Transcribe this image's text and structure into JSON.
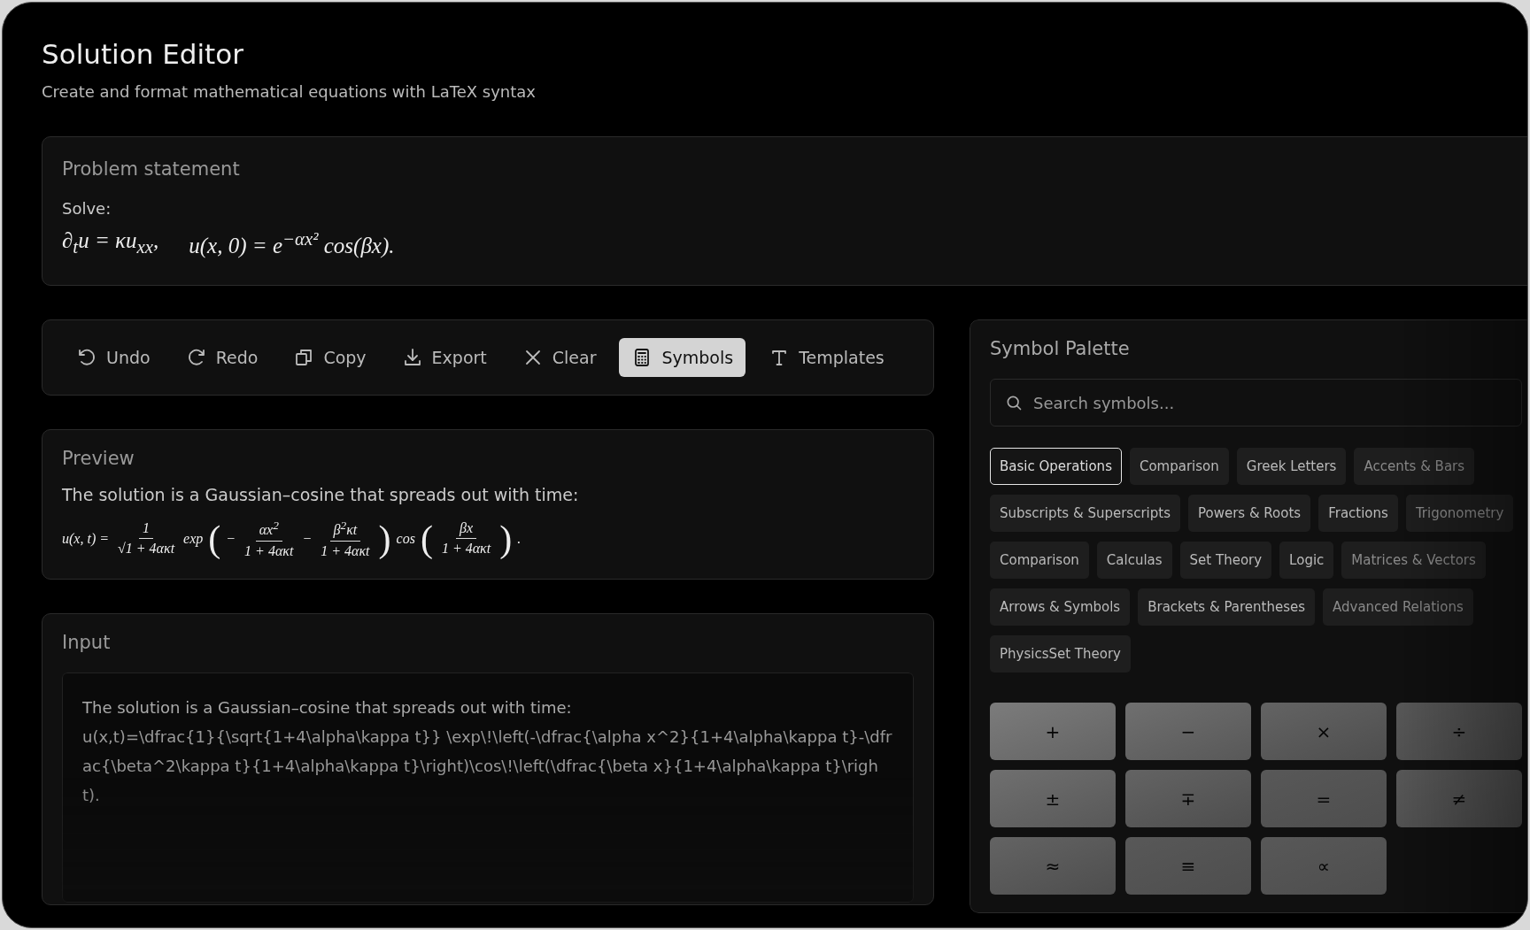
{
  "header": {
    "title": "Solution Editor",
    "subtitle": "Create and format mathematical equations with LaTeX syntax"
  },
  "problem": {
    "title": "Problem statement",
    "lead": "Solve:",
    "equations": [
      "∂$_{t}$u = κu$_{xx}$,",
      "u(x, 0) = e$^{−αx²}$ cos(βx)."
    ]
  },
  "toolbar": [
    {
      "kind": "undo",
      "label": "Undo",
      "selected": false
    },
    {
      "kind": "redo",
      "label": "Redo",
      "selected": false
    },
    {
      "kind": "copy",
      "label": "Copy",
      "selected": false
    },
    {
      "kind": "export",
      "label": "Export",
      "selected": false
    },
    {
      "kind": "clear",
      "label": "Clear",
      "selected": false
    },
    {
      "kind": "symbols",
      "label": "Symbols",
      "selected": true
    },
    {
      "kind": "templates",
      "label": "Templates",
      "selected": false
    }
  ],
  "preview": {
    "title": "Preview",
    "text": "The solution is a Gaussian–cosine that spreads out with time:",
    "formula": [
      {
        "kind": "text",
        "text": "u(x, t) ="
      },
      {
        "kind": "frac",
        "num": "1",
        "den": "√1 + 4ακt"
      },
      {
        "kind": "text",
        "text": "exp"
      },
      {
        "kind": "paren",
        "text": "("
      },
      {
        "kind": "text",
        "text": "−"
      },
      {
        "kind": "frac",
        "num": "αx$^{2}$",
        "den": "1 + 4ακt"
      },
      {
        "kind": "text",
        "text": "−"
      },
      {
        "kind": "frac",
        "num": "β$^{2}$κt",
        "den": "1 + 4ακt"
      },
      {
        "kind": "paren",
        "text": ")"
      },
      {
        "kind": "text",
        "text": "cos"
      },
      {
        "kind": "paren",
        "text": "("
      },
      {
        "kind": "frac",
        "num": "βx",
        "den": "1 + 4ακt"
      },
      {
        "kind": "paren",
        "text": ")"
      },
      {
        "kind": "text",
        "text": "."
      }
    ]
  },
  "input": {
    "title": "Input",
    "lines": [
      "The solution is a Gaussian–cosine that spreads out with time:",
      "u(x,t)=\\dfrac{1}{\\sqrt{1+4\\alpha\\kappa t}} \\exp\\!\\left(-\\dfrac{\\alpha x^2}{1+4\\alpha\\kappa t}-\\dfrac{\\beta^2\\kappa t}{1+4\\alpha\\kappa t}\\right)\\cos\\!\\left(\\dfrac{\\beta x}{1+4\\alpha\\kappa t}\\right)."
    ]
  },
  "palette": {
    "title": "Symbol Palette",
    "search": {
      "placeholder": "Search symbols..."
    },
    "categories": [
      [
        {
          "label": "Basic Operations",
          "selected": true
        },
        {
          "label": "Comparison",
          "selected": false
        },
        {
          "label": "Greek Letters",
          "selected": false
        },
        {
          "label": "Accents & Bars",
          "selected": false
        }
      ],
      [
        {
          "label": "Subscripts & Superscripts",
          "selected": false
        },
        {
          "label": "Powers & Roots",
          "selected": false
        },
        {
          "label": "Fractions",
          "selected": false
        },
        {
          "label": "Trigonometry",
          "selected": false
        }
      ],
      [
        {
          "label": "Comparison",
          "selected": false
        },
        {
          "label": "Calculas",
          "selected": false
        },
        {
          "label": "Set Theory",
          "selected": false
        },
        {
          "label": "Logic",
          "selected": false
        },
        {
          "label": "Matrices & Vectors",
          "selected": false
        }
      ],
      [
        {
          "label": "Arrows & Symbols",
          "selected": false
        },
        {
          "label": "Brackets & Parentheses",
          "selected": false
        },
        {
          "label": "Advanced Relations",
          "selected": false
        }
      ],
      [
        {
          "label": "PhysicsSet Theory",
          "selected": false
        }
      ]
    ],
    "keys": [
      "+",
      "−",
      "×",
      "÷",
      "±",
      "∓",
      "=",
      "≠",
      "≈",
      "≡",
      "∝"
    ]
  }
}
